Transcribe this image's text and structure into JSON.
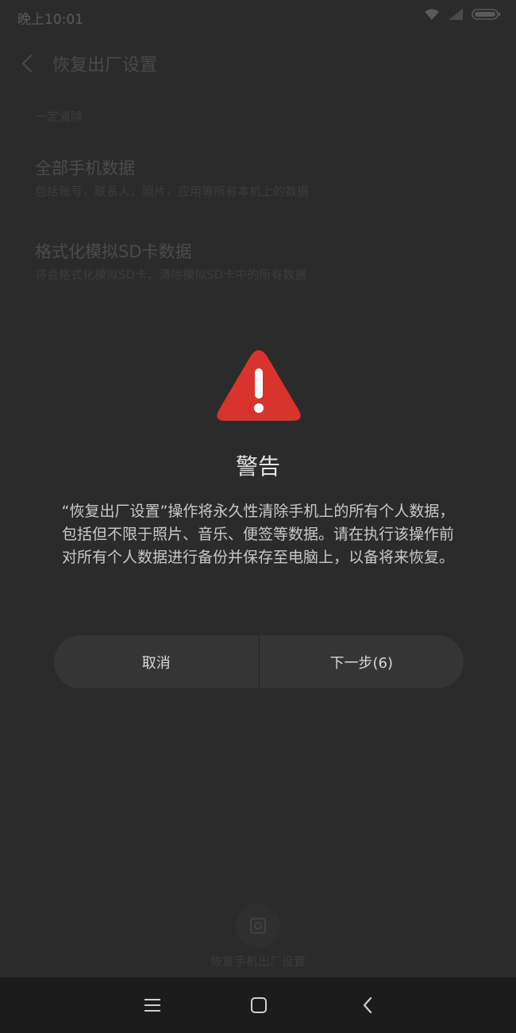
{
  "status_bar": {
    "time": "晚上10:01",
    "icons": [
      "wifi-icon",
      "signal-icon",
      "battery-icon"
    ]
  },
  "header": {
    "back_icon": "chevron-left-icon",
    "title": "恢复出厂设置"
  },
  "background": {
    "section_label": "一定清除",
    "items": [
      {
        "title": "全部手机数据",
        "desc": "包括账号，联系人，照片，应用等所有本机上的数据"
      },
      {
        "title": "格式化模拟SD卡数据",
        "desc": "将会格式化模拟SD卡，清除模拟SD卡中的所有数据"
      }
    ],
    "reset_button_label": "恢复手机出厂设置"
  },
  "dialog": {
    "icon": "warning-icon",
    "title": "警告",
    "message": "“恢复出厂设置”操作将永久性清除手机上的所有个人数据，包括但不限于照片、音乐、便签等数据。请在执行该操作前对所有个人数据进行备份并保存至电脑上，以备将来恢复。",
    "cancel_label": "取消",
    "next_label": "下一步(6)"
  },
  "nav_bar": {
    "icons": [
      "menu-icon",
      "home-icon",
      "back-icon"
    ]
  },
  "colors": {
    "warning_red": "#d8342d",
    "background": "#2b2b2b",
    "nav_bar": "#1c1c1c"
  }
}
